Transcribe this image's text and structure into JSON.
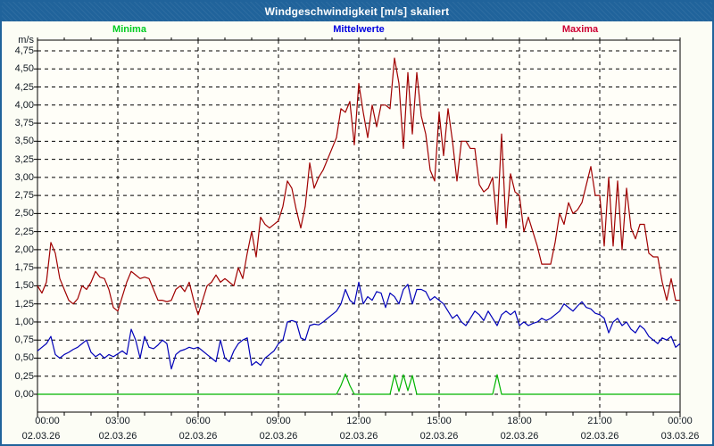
{
  "window": {
    "title": "Windgeschwindigkeit [m/s] skaliert"
  },
  "colors": {
    "window_frame": "#20639b",
    "titlebar_text": "#ffffff",
    "outer_background": "#fcfdf5",
    "plot_background": "#fffef8",
    "gridline": "#000000",
    "tick_label": "#101820"
  },
  "chart_data": {
    "type": "line",
    "title": "Windgeschwindigkeit [m/s] skaliert",
    "ylabel": "m/s",
    "xlabel": "",
    "ylim": [
      -0.25,
      4.9
    ],
    "grid": "dashed, horizontal every 0.25 m/s, vertical every 3 h",
    "legend_position": "top",
    "sample_interval_minutes": 10,
    "x_start_hour": 0,
    "x_end_hour": 24,
    "y_tick_step": 0.25,
    "y_tick_labels": [
      "0,00",
      "0,25",
      "0,50",
      "0,75",
      "1,00",
      "1,25",
      "1,50",
      "1,75",
      "2,00",
      "2,25",
      "2,50",
      "2,75",
      "3,00",
      "3,25",
      "3,50",
      "3,75",
      "4,00",
      "4,25",
      "4,50",
      "4,75"
    ],
    "x_ticks": [
      {
        "time": "00:00",
        "date": "02.03.26"
      },
      {
        "time": "03:00",
        "date": "02.03.26"
      },
      {
        "time": "06:00",
        "date": "02.03.26"
      },
      {
        "time": "09:00",
        "date": "02.03.26"
      },
      {
        "time": "12:00",
        "date": "02.03.26"
      },
      {
        "time": "15:00",
        "date": "02.03.26"
      },
      {
        "time": "18:00",
        "date": "02.03.26"
      },
      {
        "time": "21:00",
        "date": "02.03.26"
      },
      {
        "time": "00:00",
        "date": "03.03.26"
      }
    ],
    "series": [
      {
        "name": "Minima",
        "color": "#00b400",
        "label_color": "#00cc22",
        "values": [
          0,
          0,
          0,
          0,
          0,
          0,
          0,
          0,
          0,
          0,
          0,
          0,
          0,
          0,
          0,
          0,
          0,
          0,
          0,
          0,
          0,
          0,
          0,
          0,
          0,
          0,
          0,
          0,
          0,
          0,
          0,
          0,
          0,
          0,
          0,
          0,
          0,
          0,
          0,
          0,
          0,
          0,
          0,
          0,
          0,
          0,
          0,
          0,
          0,
          0,
          0,
          0,
          0,
          0,
          0,
          0,
          0,
          0,
          0,
          0,
          0,
          0,
          0,
          0,
          0,
          0,
          0,
          0,
          0.12,
          0.28,
          0.12,
          0,
          0,
          0,
          0,
          0,
          0,
          0,
          0,
          0,
          0.27,
          0.04,
          0.27,
          0.05,
          0.26,
          0,
          0,
          0,
          0,
          0,
          0,
          0,
          0,
          0,
          0,
          0,
          0,
          0,
          0,
          0,
          0,
          0,
          0,
          0.27,
          0,
          0,
          0,
          0,
          0,
          0,
          0,
          0,
          0,
          0,
          0,
          0,
          0,
          0,
          0,
          0,
          0,
          0,
          0,
          0,
          0,
          0,
          0,
          0,
          0,
          0,
          0,
          0,
          0,
          0,
          0,
          0,
          0,
          0,
          0,
          0,
          0,
          0,
          0,
          0,
          0
        ]
      },
      {
        "name": "Mittelwerte",
        "color": "#0000b8",
        "label_color": "#0000e0",
        "values": [
          0.6,
          0.65,
          0.7,
          0.8,
          0.55,
          0.5,
          0.55,
          0.58,
          0.62,
          0.65,
          0.7,
          0.75,
          0.58,
          0.52,
          0.56,
          0.5,
          0.55,
          0.52,
          0.56,
          0.6,
          0.55,
          0.9,
          0.75,
          0.5,
          0.8,
          0.65,
          0.63,
          0.68,
          0.75,
          0.7,
          0.35,
          0.55,
          0.6,
          0.62,
          0.65,
          0.63,
          0.65,
          0.6,
          0.55,
          0.5,
          0.45,
          0.75,
          0.5,
          0.45,
          0.6,
          0.7,
          0.75,
          0.78,
          0.4,
          0.45,
          0.4,
          0.5,
          0.55,
          0.6,
          0.7,
          0.75,
          1.0,
          1.02,
          1.0,
          0.78,
          0.75,
          0.95,
          0.97,
          0.96,
          1.0,
          1.05,
          1.1,
          1.15,
          1.25,
          1.45,
          1.3,
          1.25,
          1.55,
          1.25,
          1.35,
          1.3,
          1.42,
          1.4,
          1.2,
          1.4,
          1.35,
          1.25,
          1.45,
          1.52,
          1.25,
          1.45,
          1.45,
          1.42,
          1.3,
          1.35,
          1.3,
          1.25,
          1.15,
          1.05,
          1.1,
          1.0,
          0.95,
          1.05,
          1.15,
          1.1,
          1.02,
          1.15,
          1.05,
          0.95,
          1.1,
          1.15,
          1.1,
          1.15,
          0.95,
          1.0,
          0.95,
          0.98,
          1.0,
          1.05,
          1.02,
          1.05,
          1.1,
          1.15,
          1.25,
          1.2,
          1.15,
          1.22,
          1.28,
          1.2,
          1.18,
          1.12,
          1.1,
          1.05,
          0.85,
          1.0,
          1.05,
          0.95,
          1.0,
          0.9,
          0.85,
          0.95,
          0.9,
          0.8,
          0.75,
          0.7,
          0.78,
          0.75,
          0.8,
          0.65,
          0.7
        ]
      },
      {
        "name": "Maxima",
        "color": "#a00000",
        "label_color": "#cc0033",
        "values": [
          1.5,
          1.4,
          1.55,
          2.1,
          1.95,
          1.6,
          1.45,
          1.3,
          1.25,
          1.32,
          1.5,
          1.45,
          1.55,
          1.7,
          1.62,
          1.6,
          1.45,
          1.2,
          1.15,
          1.35,
          1.55,
          1.7,
          1.65,
          1.6,
          1.62,
          1.6,
          1.45,
          1.3,
          1.3,
          1.28,
          1.3,
          1.45,
          1.5,
          1.42,
          1.55,
          1.3,
          1.1,
          1.3,
          1.5,
          1.55,
          1.65,
          1.55,
          1.6,
          1.55,
          1.5,
          1.75,
          1.6,
          1.95,
          2.25,
          1.9,
          2.45,
          2.35,
          2.3,
          2.35,
          2.4,
          2.6,
          2.95,
          2.85,
          2.55,
          2.3,
          2.6,
          3.2,
          2.85,
          3.0,
          3.1,
          3.25,
          3.4,
          3.55,
          3.95,
          3.9,
          4.05,
          3.45,
          4.3,
          3.9,
          3.55,
          4.0,
          3.7,
          4.0,
          4.0,
          3.95,
          4.65,
          4.3,
          3.4,
          4.45,
          3.6,
          4.45,
          3.85,
          3.6,
          3.1,
          2.95,
          3.9,
          3.3,
          3.95,
          3.5,
          2.95,
          3.5,
          3.5,
          3.4,
          3.4,
          2.9,
          2.8,
          2.85,
          3.0,
          2.35,
          3.6,
          2.3,
          3.05,
          2.8,
          2.75,
          2.25,
          2.45,
          2.25,
          2.05,
          1.8,
          1.8,
          1.8,
          2.1,
          2.5,
          2.35,
          2.65,
          2.5,
          2.55,
          2.65,
          2.9,
          3.15,
          2.75,
          2.75,
          2.05,
          3.0,
          2.05,
          2.95,
          2.0,
          2.85,
          2.3,
          2.15,
          2.35,
          2.35,
          1.95,
          1.9,
          1.9,
          1.55,
          1.3,
          1.6,
          1.3,
          1.3
        ]
      }
    ]
  }
}
